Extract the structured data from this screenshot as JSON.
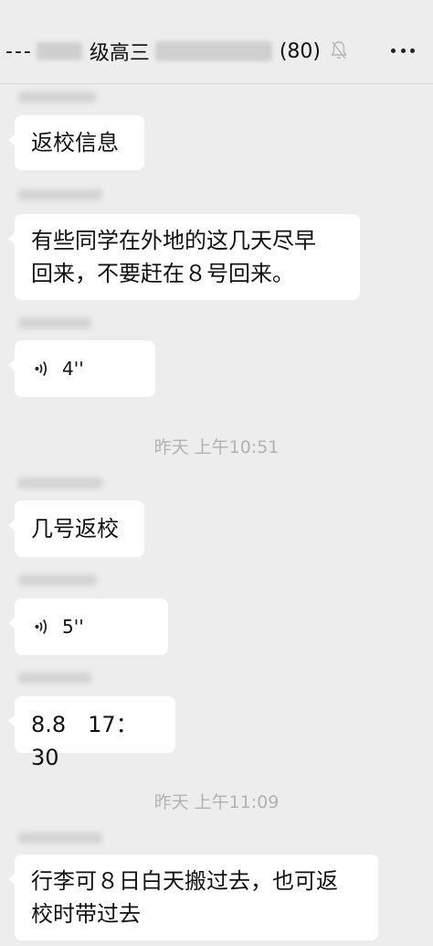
{
  "header": {
    "title_prefix": "---",
    "title_grade": "级高三",
    "member_count": "(80)",
    "mute_icon": "bell-off-icon",
    "more_icon": "more-dots-icon"
  },
  "messages": [
    {
      "type": "text",
      "text": "返校信息"
    },
    {
      "type": "text",
      "lines": [
        "有些同学在外地的这几天尽早",
        "回来，不要赶在８号回来。"
      ]
    },
    {
      "type": "voice",
      "duration": "4''",
      "icon": "voice-wave-icon"
    },
    {
      "type": "time",
      "text": "昨天 上午10:51"
    },
    {
      "type": "text",
      "text": "几号返校"
    },
    {
      "type": "voice",
      "duration": "5''",
      "icon": "voice-wave-icon"
    },
    {
      "type": "text",
      "text": "8.8　17：30"
    },
    {
      "type": "time",
      "text": "昨天 上午11:09"
    },
    {
      "type": "text",
      "lines": [
        "行李可８日白天搬过去，也可返",
        "校时带过去"
      ]
    }
  ],
  "colors": {
    "background": "#ededed",
    "bubble": "#ffffff",
    "timestamp": "#b2b2b2"
  }
}
